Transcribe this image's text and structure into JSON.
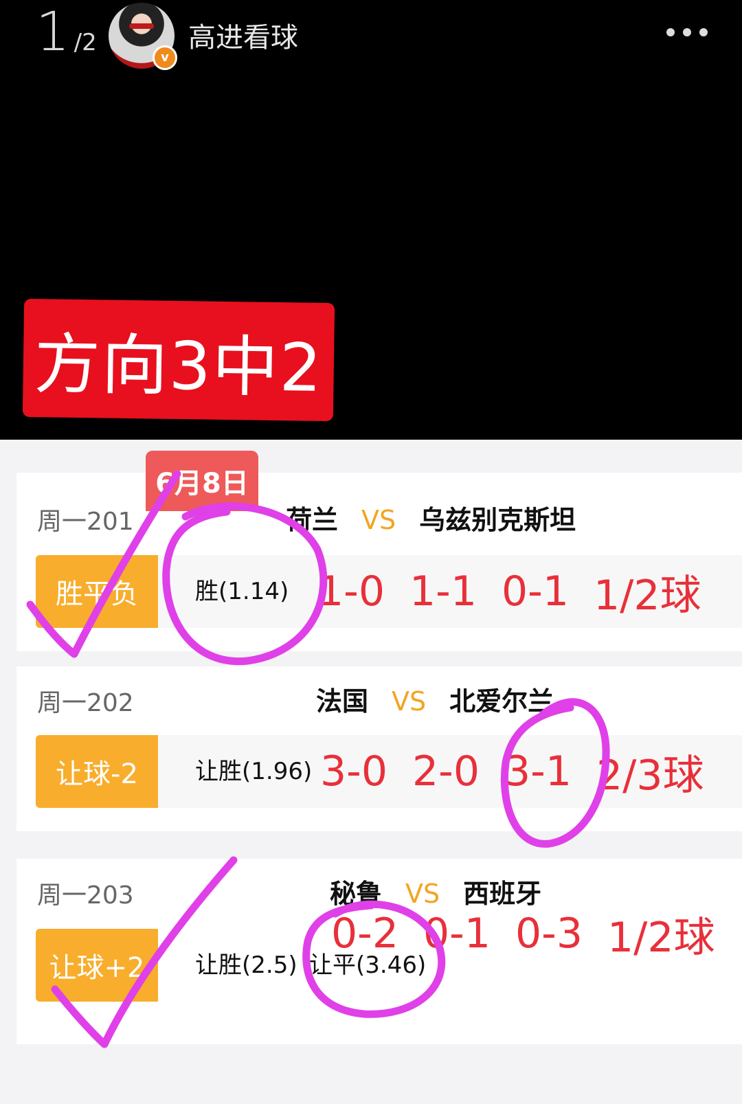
{
  "viewer": {
    "page_current": "1",
    "page_sep": "/",
    "page_total": "2",
    "username": "高进看球",
    "verified_badge": "v"
  },
  "banner": {
    "text": "方向3中2",
    "color": "#e8101e"
  },
  "date_badge": "6月8日",
  "matches": [
    {
      "id": "周一201",
      "home": "荷兰",
      "vs": "VS",
      "away": "乌兹别克斯坦",
      "tag": "胜平负",
      "odds": [
        "胜(1.14)"
      ],
      "scores": [
        "1-0",
        "1-1",
        "0-1",
        "1/2球"
      ]
    },
    {
      "id": "周一202",
      "home": "法国",
      "vs": "VS",
      "away": "北爱尔兰",
      "tag": "让球-2",
      "odds": [
        "让胜(1.96)"
      ],
      "scores": [
        "3-0",
        "2-0",
        "3-1",
        "2/3球"
      ]
    },
    {
      "id": "周一203",
      "home": "秘鲁",
      "vs": "VS",
      "away": "西班牙",
      "tag": "让球+2",
      "odds": [
        "让胜(2.5)",
        "让平(3.46)"
      ],
      "scores": [
        "0-2",
        "0-1",
        "0-3",
        "1/2球"
      ]
    }
  ],
  "colors": {
    "tag_bg": "#f8ad2c",
    "score_red": "#e8303a",
    "vs_orange": "#f2a51f",
    "annotation_magenta": "#e040e8"
  },
  "annotations": [
    "checkmark",
    "circle",
    "circle",
    "checkmark",
    "circle"
  ]
}
